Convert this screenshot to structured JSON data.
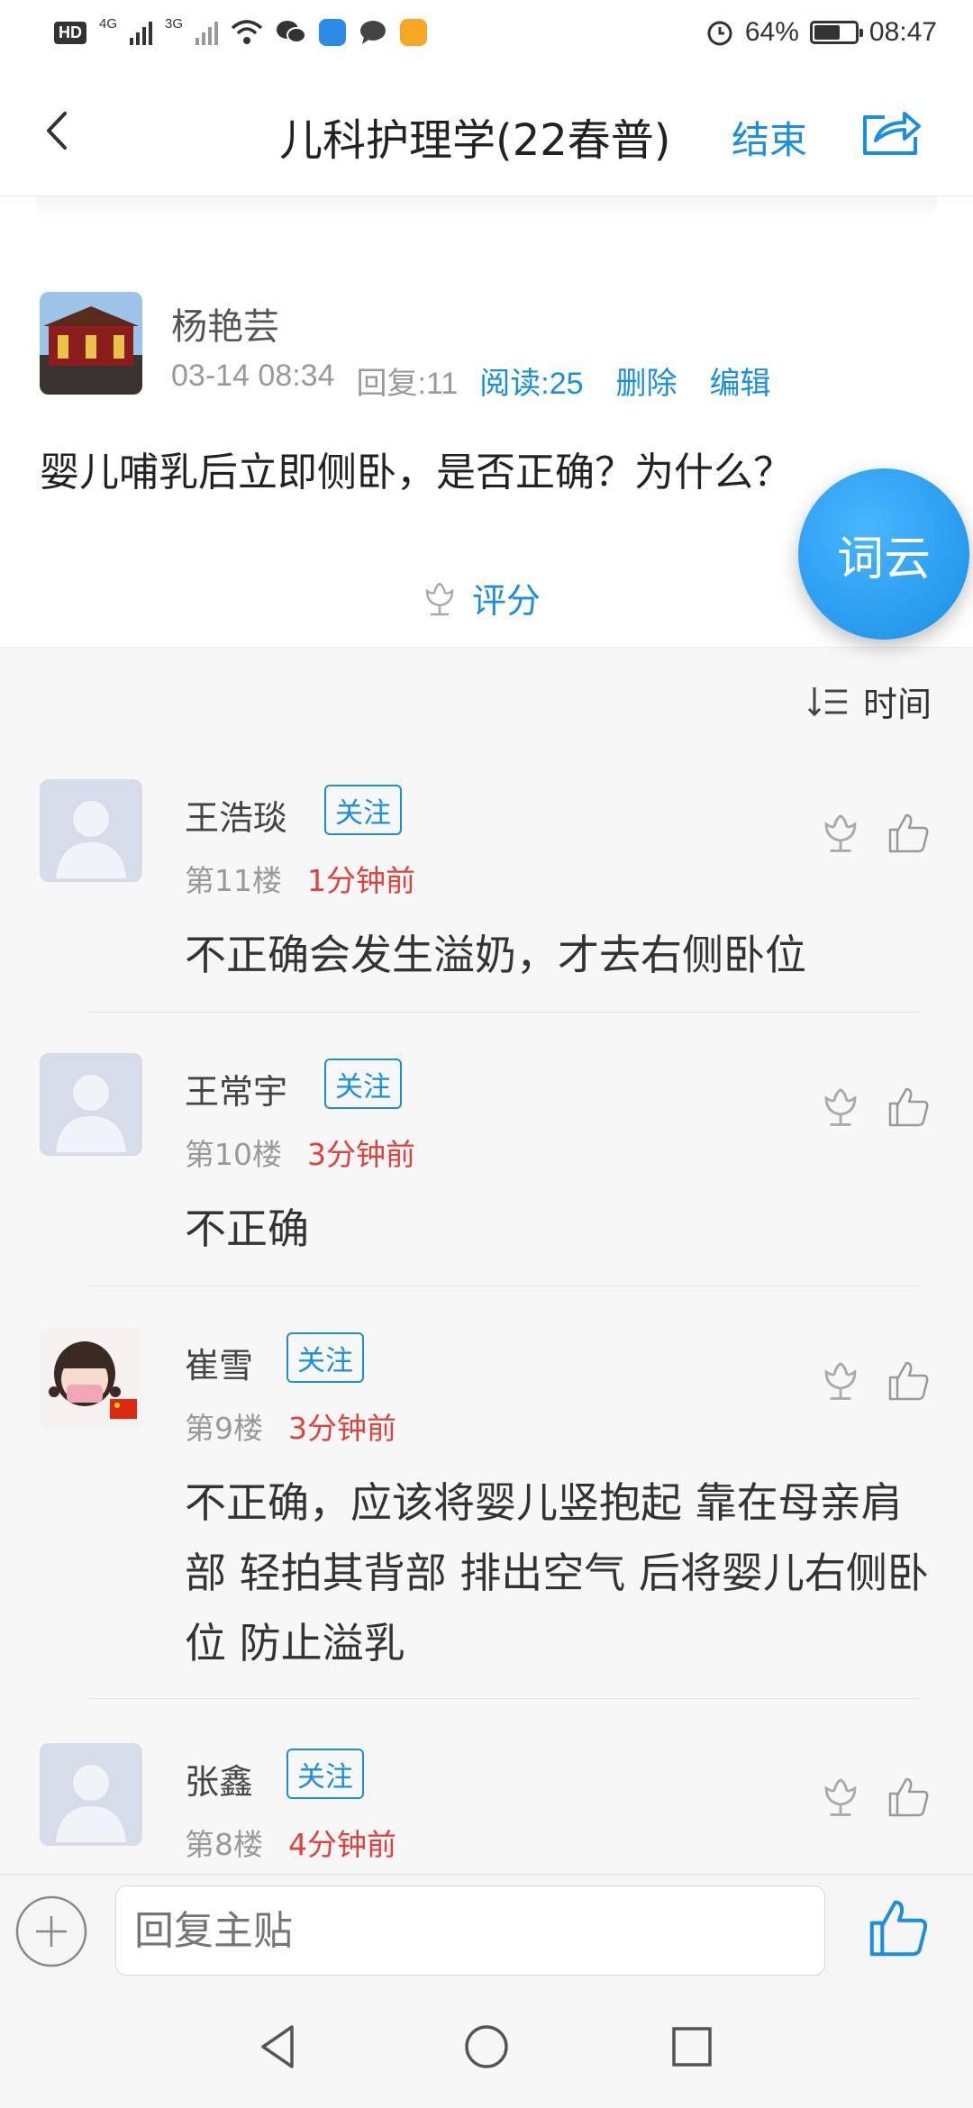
{
  "status_bar": {
    "hd_label": "HD",
    "net1": "4G",
    "net2": "3G",
    "battery_percent": "64%",
    "battery_level": 0.64,
    "time": "08:47"
  },
  "nav": {
    "title": "儿科护理学(22春普)",
    "end_label": "结束",
    "back_icon": "back-chevron-icon",
    "share_icon": "share-icon"
  },
  "post": {
    "author": "杨艳芸",
    "date": "03-14 08:34",
    "replies": "回复:11",
    "reads": "阅读:25",
    "delete_label": "删除",
    "edit_label": "编辑",
    "body": "婴儿哺乳后立即侧卧，是否正确？为什么？",
    "rate_label": "评分"
  },
  "floating_button": {
    "label": "词云"
  },
  "sort": {
    "label": "时间"
  },
  "comments": [
    {
      "name": "王浩琰",
      "follow": "关注",
      "floor": "第11楼",
      "time": "1分钟前",
      "text": "不正确会发生溢奶，才去右侧卧位"
    },
    {
      "name": "王常宇",
      "follow": "关注",
      "floor": "第10楼",
      "time": "3分钟前",
      "text": "不正确"
    },
    {
      "name": "崔雪",
      "follow": "关注",
      "floor": "第9楼",
      "time": "3分钟前",
      "text": "不正确，应该将婴儿竖抱起 靠在母亲肩部 轻拍其背部 排出空气 后将婴儿右侧卧位 防止溢乳"
    },
    {
      "name": "张鑫",
      "follow": "关注",
      "floor": "第8楼",
      "time": "4分钟前",
      "text": ""
    }
  ],
  "reply_bar": {
    "placeholder": "回复主贴"
  },
  "colors": {
    "accent": "#1a8fe0",
    "time_red": "#e0413a"
  }
}
